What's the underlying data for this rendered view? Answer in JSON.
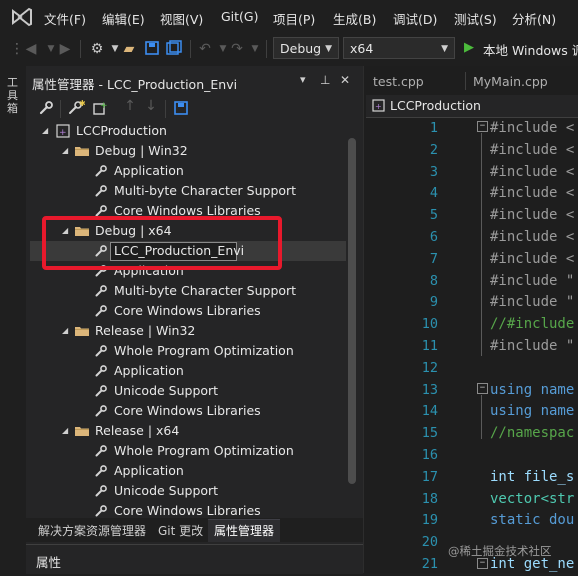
{
  "menubar": {
    "items": [
      "文件(F)",
      "编辑(E)",
      "视图(V)",
      "Git(G)",
      "项目(P)",
      "生成(B)",
      "调试(D)",
      "测试(S)",
      "分析(N)"
    ]
  },
  "toolbar": {
    "configuration": "Debug",
    "platform": "x64",
    "run_label": "本地 Windows 调"
  },
  "toolbox": {
    "label": "工具箱"
  },
  "property_manager": {
    "title": "属性管理器 - LCC_Production_Envi",
    "tree": {
      "project": "LCCProduction",
      "groups": [
        {
          "label": "Debug | Win32",
          "items": [
            "Application",
            "Multi-byte Character Support",
            "Core Windows Libraries"
          ]
        },
        {
          "label": "Debug | x64",
          "items": [
            "LCC_Production_Envi",
            "Application",
            "Multi-byte Character Support",
            "Core Windows Libraries"
          ]
        },
        {
          "label": "Release | Win32",
          "items": [
            "Whole Program Optimization",
            "Application",
            "Unicode Support",
            "Core Windows Libraries"
          ]
        },
        {
          "label": "Release | x64",
          "items": [
            "Whole Program Optimization",
            "Application",
            "Unicode Support",
            "Core Windows Libraries"
          ]
        }
      ]
    }
  },
  "bottom_tabs": [
    "解决方案资源管理器",
    "Git 更改",
    "属性管理器"
  ],
  "properties_panel": {
    "title": "属性"
  },
  "editor": {
    "tabs": [
      "test.cpp",
      "MyMain.cpp"
    ],
    "nav_label": "LCCProduction",
    "line_numbers": [
      "1",
      "2",
      "3",
      "4",
      "5",
      "6",
      "7",
      "8",
      "9",
      "10",
      "11",
      "12",
      "13",
      "14",
      "15",
      "16",
      "17",
      "18",
      "19",
      "20",
      "21"
    ],
    "lines": [
      {
        "text": "#include <",
        "color": "#9b9b9b"
      },
      {
        "text": "#include <",
        "color": "#9b9b9b"
      },
      {
        "text": "#include <",
        "color": "#9b9b9b"
      },
      {
        "text": "#include <",
        "color": "#9b9b9b"
      },
      {
        "text": "#include <",
        "color": "#9b9b9b"
      },
      {
        "text": "#include <",
        "color": "#9b9b9b"
      },
      {
        "text": "#include <",
        "color": "#9b9b9b"
      },
      {
        "text": "#include \"",
        "color": "#9b9b9b"
      },
      {
        "text": "#include \"",
        "color": "#9b9b9b"
      },
      {
        "text": "//#include",
        "color": "#57a64a"
      },
      {
        "text": "#include \"",
        "color": "#9b9b9b"
      },
      {
        "text": "",
        "color": "#9b9b9b"
      },
      {
        "text": "using name",
        "color": "#569cd6"
      },
      {
        "text": "using name",
        "color": "#569cd6"
      },
      {
        "text": "//namespac",
        "color": "#57a64a"
      },
      {
        "text": "",
        "color": "#9b9b9b"
      },
      {
        "text": "int file_s",
        "color": "#9cdcfe"
      },
      {
        "text": "vector<str",
        "color": "#4ec9b0"
      },
      {
        "text": "static dou",
        "color": "#569cd6"
      },
      {
        "text": "",
        "color": "#9b9b9b"
      },
      {
        "text": "int get_ne",
        "color": "#9cdcfe"
      }
    ]
  },
  "watermark": "@稀土掘金技术社区",
  "colors": {
    "highlight_box": "#e8192c",
    "line_number": "#2b91af",
    "folder": "#dcb67a",
    "run_arrow": "#4cbb3c",
    "save_icon": "#3c8df0"
  }
}
